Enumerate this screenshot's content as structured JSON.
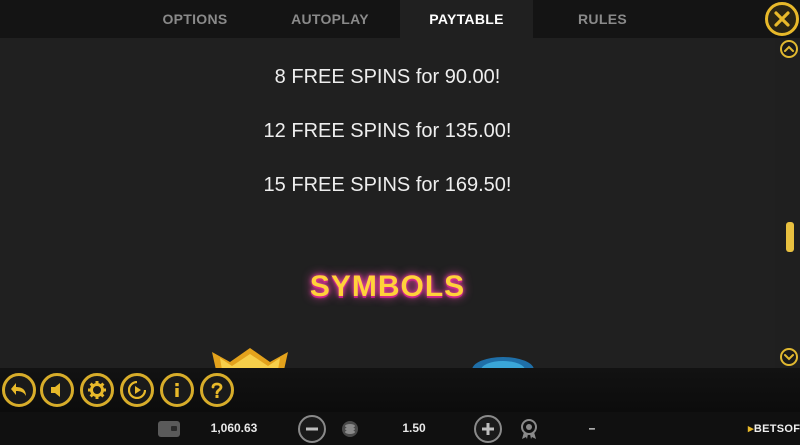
{
  "tabs": [
    {
      "label": "OPTIONS",
      "active": false
    },
    {
      "label": "AUTOPLAY",
      "active": false
    },
    {
      "label": "PAYTABLE",
      "active": true
    },
    {
      "label": "RULES",
      "active": false
    }
  ],
  "paytable": {
    "free_spins": [
      "8 FREE SPINS for 90.00!",
      "12 FREE SPINS for 135.00!",
      "15 FREE SPINS for 169.50!"
    ],
    "section_title": "SYMBOLS"
  },
  "controls": {
    "icons": [
      "back-arrow-icon",
      "sound-icon",
      "settings-gear-icon",
      "autoplay-icon",
      "info-icon",
      "help-icon"
    ]
  },
  "status": {
    "balance": "1,060.63",
    "bet": "1.50",
    "win": "–"
  },
  "brand": {
    "logo_text": "BETSOFT"
  },
  "colors": {
    "accent": "#e8b92a",
    "tab_active_text": "#ffffff",
    "tab_inactive_text": "#8a8a8a",
    "title_fill": "#ffd23a",
    "title_glow": "#ff4fb8"
  }
}
